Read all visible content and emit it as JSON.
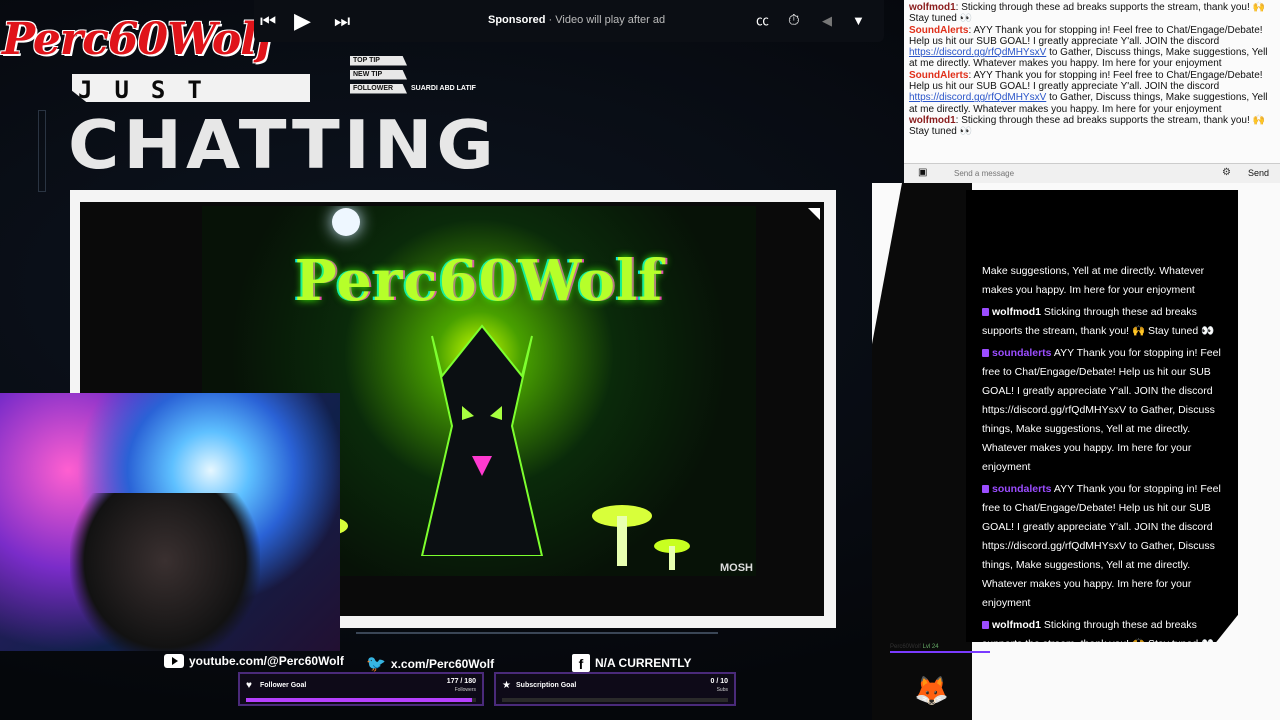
{
  "overlay": {
    "brand": "Perc60Wolf",
    "just": "JUST",
    "chatting": "CHATTING",
    "alerts": [
      {
        "label": "TOP TIP",
        "value": ""
      },
      {
        "label": "NEW TIP",
        "value": ""
      },
      {
        "label": "FOLLOWER",
        "value": "SUARDI ABD LATIF"
      }
    ],
    "art_title": "Perc60Wolf",
    "art_credit": "MOSH",
    "socials": {
      "youtube": "youtube.com/@Perc60Wolf",
      "x": "x.com/Perc60Wolf",
      "facebook": "N/A CURRENTLY"
    },
    "follower_goal": {
      "label": "Follower Goal",
      "count": "177 / 180",
      "unit": "Followers",
      "progress": 0.983
    },
    "sub_goal": {
      "label": "Subscription Goal",
      "count": "0 / 10",
      "unit": "Subs",
      "progress": 0.0
    },
    "level": {
      "name": "Perc60Wolf",
      "lvl": "Lvl 24"
    }
  },
  "player": {
    "sponsored": "Sponsored",
    "sponsored_sub": "Video will play after ad",
    "icons": [
      "prev-icon",
      "play-icon",
      "next-icon",
      "captions-icon",
      "timer-icon",
      "chevron-left-icon",
      "chevron-down-icon"
    ]
  },
  "chat_top": {
    "messages": [
      {
        "user": "wolfmod1",
        "type": "wolf",
        "text": "Sticking through these ad breaks supports the stream, thank you! 🙌 Stay tuned 👀"
      },
      {
        "user": "SoundAlerts",
        "type": "sound",
        "text": "AYY Thank you for stopping in! Feel free to Chat/Engage/Debate! Help us hit our SUB GOAL! I greatly appreciate Y'all. JOIN the discord",
        "link": "https://discord.gg/rfQdMHYsxV",
        "after": "to Gather, Discuss things, Make suggestions, Yell at me directly. Whatever makes you happy. Im here for your enjoyment"
      },
      {
        "user": "SoundAlerts",
        "type": "sound",
        "text": "AYY Thank you for stopping in! Feel free to Chat/Engage/Debate! Help us hit our SUB GOAL! I greatly appreciate Y'all. JOIN the discord",
        "link": "https://discord.gg/rfQdMHYsxV",
        "after": "to Gather, Discuss things, Make suggestions, Yell at me directly. Whatever makes you happy. Im here for your enjoyment"
      },
      {
        "user": "wolfmod1",
        "type": "wolf",
        "text": "Sticking through these ad breaks supports the stream, thank you! 🙌 Stay tuned 👀"
      }
    ],
    "placeholder": "Send a message",
    "send": "Send"
  },
  "overlay_chat": {
    "messages": [
      {
        "user": "",
        "cls": "",
        "text": "Make suggestions, Yell at me directly. Whatever makes you happy. Im here for your enjoyment"
      },
      {
        "user": "wolfmod1",
        "cls": "",
        "text": "Sticking through these ad breaks supports the stream, thank you! 🙌 Stay tuned 👀"
      },
      {
        "user": "soundalerts",
        "cls": "purple",
        "text": "AYY Thank you for stopping in! Feel free to Chat/Engage/Debate! Help us hit our SUB GOAL! I greatly appreciate Y'all. JOIN the discord https://discord.gg/rfQdMHYsxV to Gather, Discuss things, Make suggestions, Yell at me directly. Whatever makes you happy. Im here for your enjoyment"
      },
      {
        "user": "soundalerts",
        "cls": "purple",
        "text": "AYY Thank you for stopping in! Feel free to Chat/Engage/Debate! Help us hit our SUB GOAL! I greatly appreciate Y'all. JOIN the discord https://discord.gg/rfQdMHYsxV to Gather, Discuss things, Make suggestions, Yell at me directly. Whatever makes you happy. Im here for your enjoyment"
      },
      {
        "user": "wolfmod1",
        "cls": "",
        "text": "Sticking through these ad breaks supports the stream, thank you! 🙌 Stay tuned 👀"
      }
    ]
  },
  "colors": {
    "accent": "#9b4dff",
    "brand_red": "#e0141a",
    "art_green": "#b6ff2a"
  }
}
